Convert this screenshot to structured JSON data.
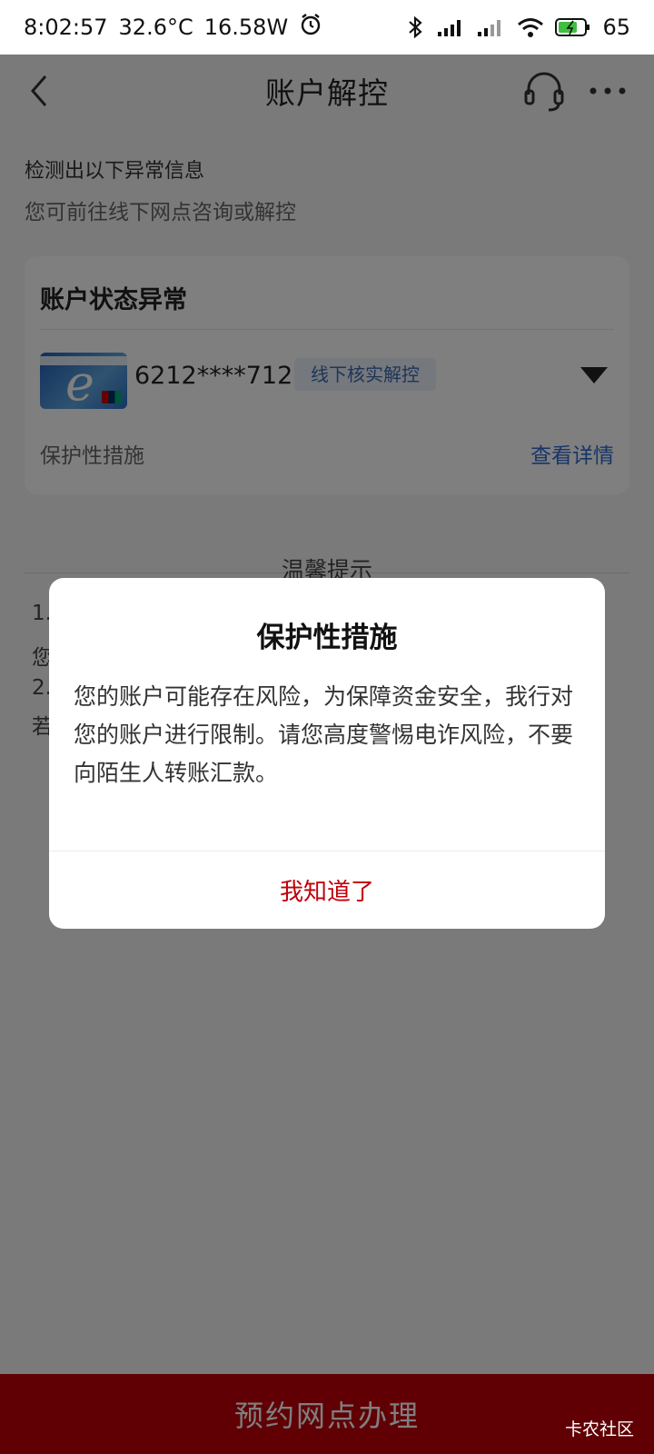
{
  "status_bar": {
    "time": "8:02:57",
    "temperature": "32.6°C",
    "power": "16.58W",
    "battery": "65"
  },
  "navbar": {
    "title": "账户解控"
  },
  "notice": {
    "line1": "检测出以下异常信息",
    "line2": "您可前往线下网点咨询或解控"
  },
  "account_card": {
    "title": "账户状态异常",
    "card_number": "6212****7120",
    "tag": "线下核实解控",
    "measure_label": "保护性措施",
    "detail_link": "查看详情"
  },
  "tips": {
    "title": "温馨提示",
    "items": [
      "1.",
      "您",
      "2.",
      "若"
    ]
  },
  "dialog": {
    "title": "保护性措施",
    "body": "您的账户可能存在风险，为保障资金安全，我行对您的账户进行限制。请您高度警惕电诈风险，不要向陌生人转账汇款。",
    "button": "我知道了"
  },
  "bottom_bar": {
    "label": "预约网点办理"
  },
  "watermark": "卡农社区",
  "colors": {
    "accent_red": "#c0000a",
    "link_blue": "#2f6bd0",
    "tag_blue": "#3c6bb0"
  }
}
